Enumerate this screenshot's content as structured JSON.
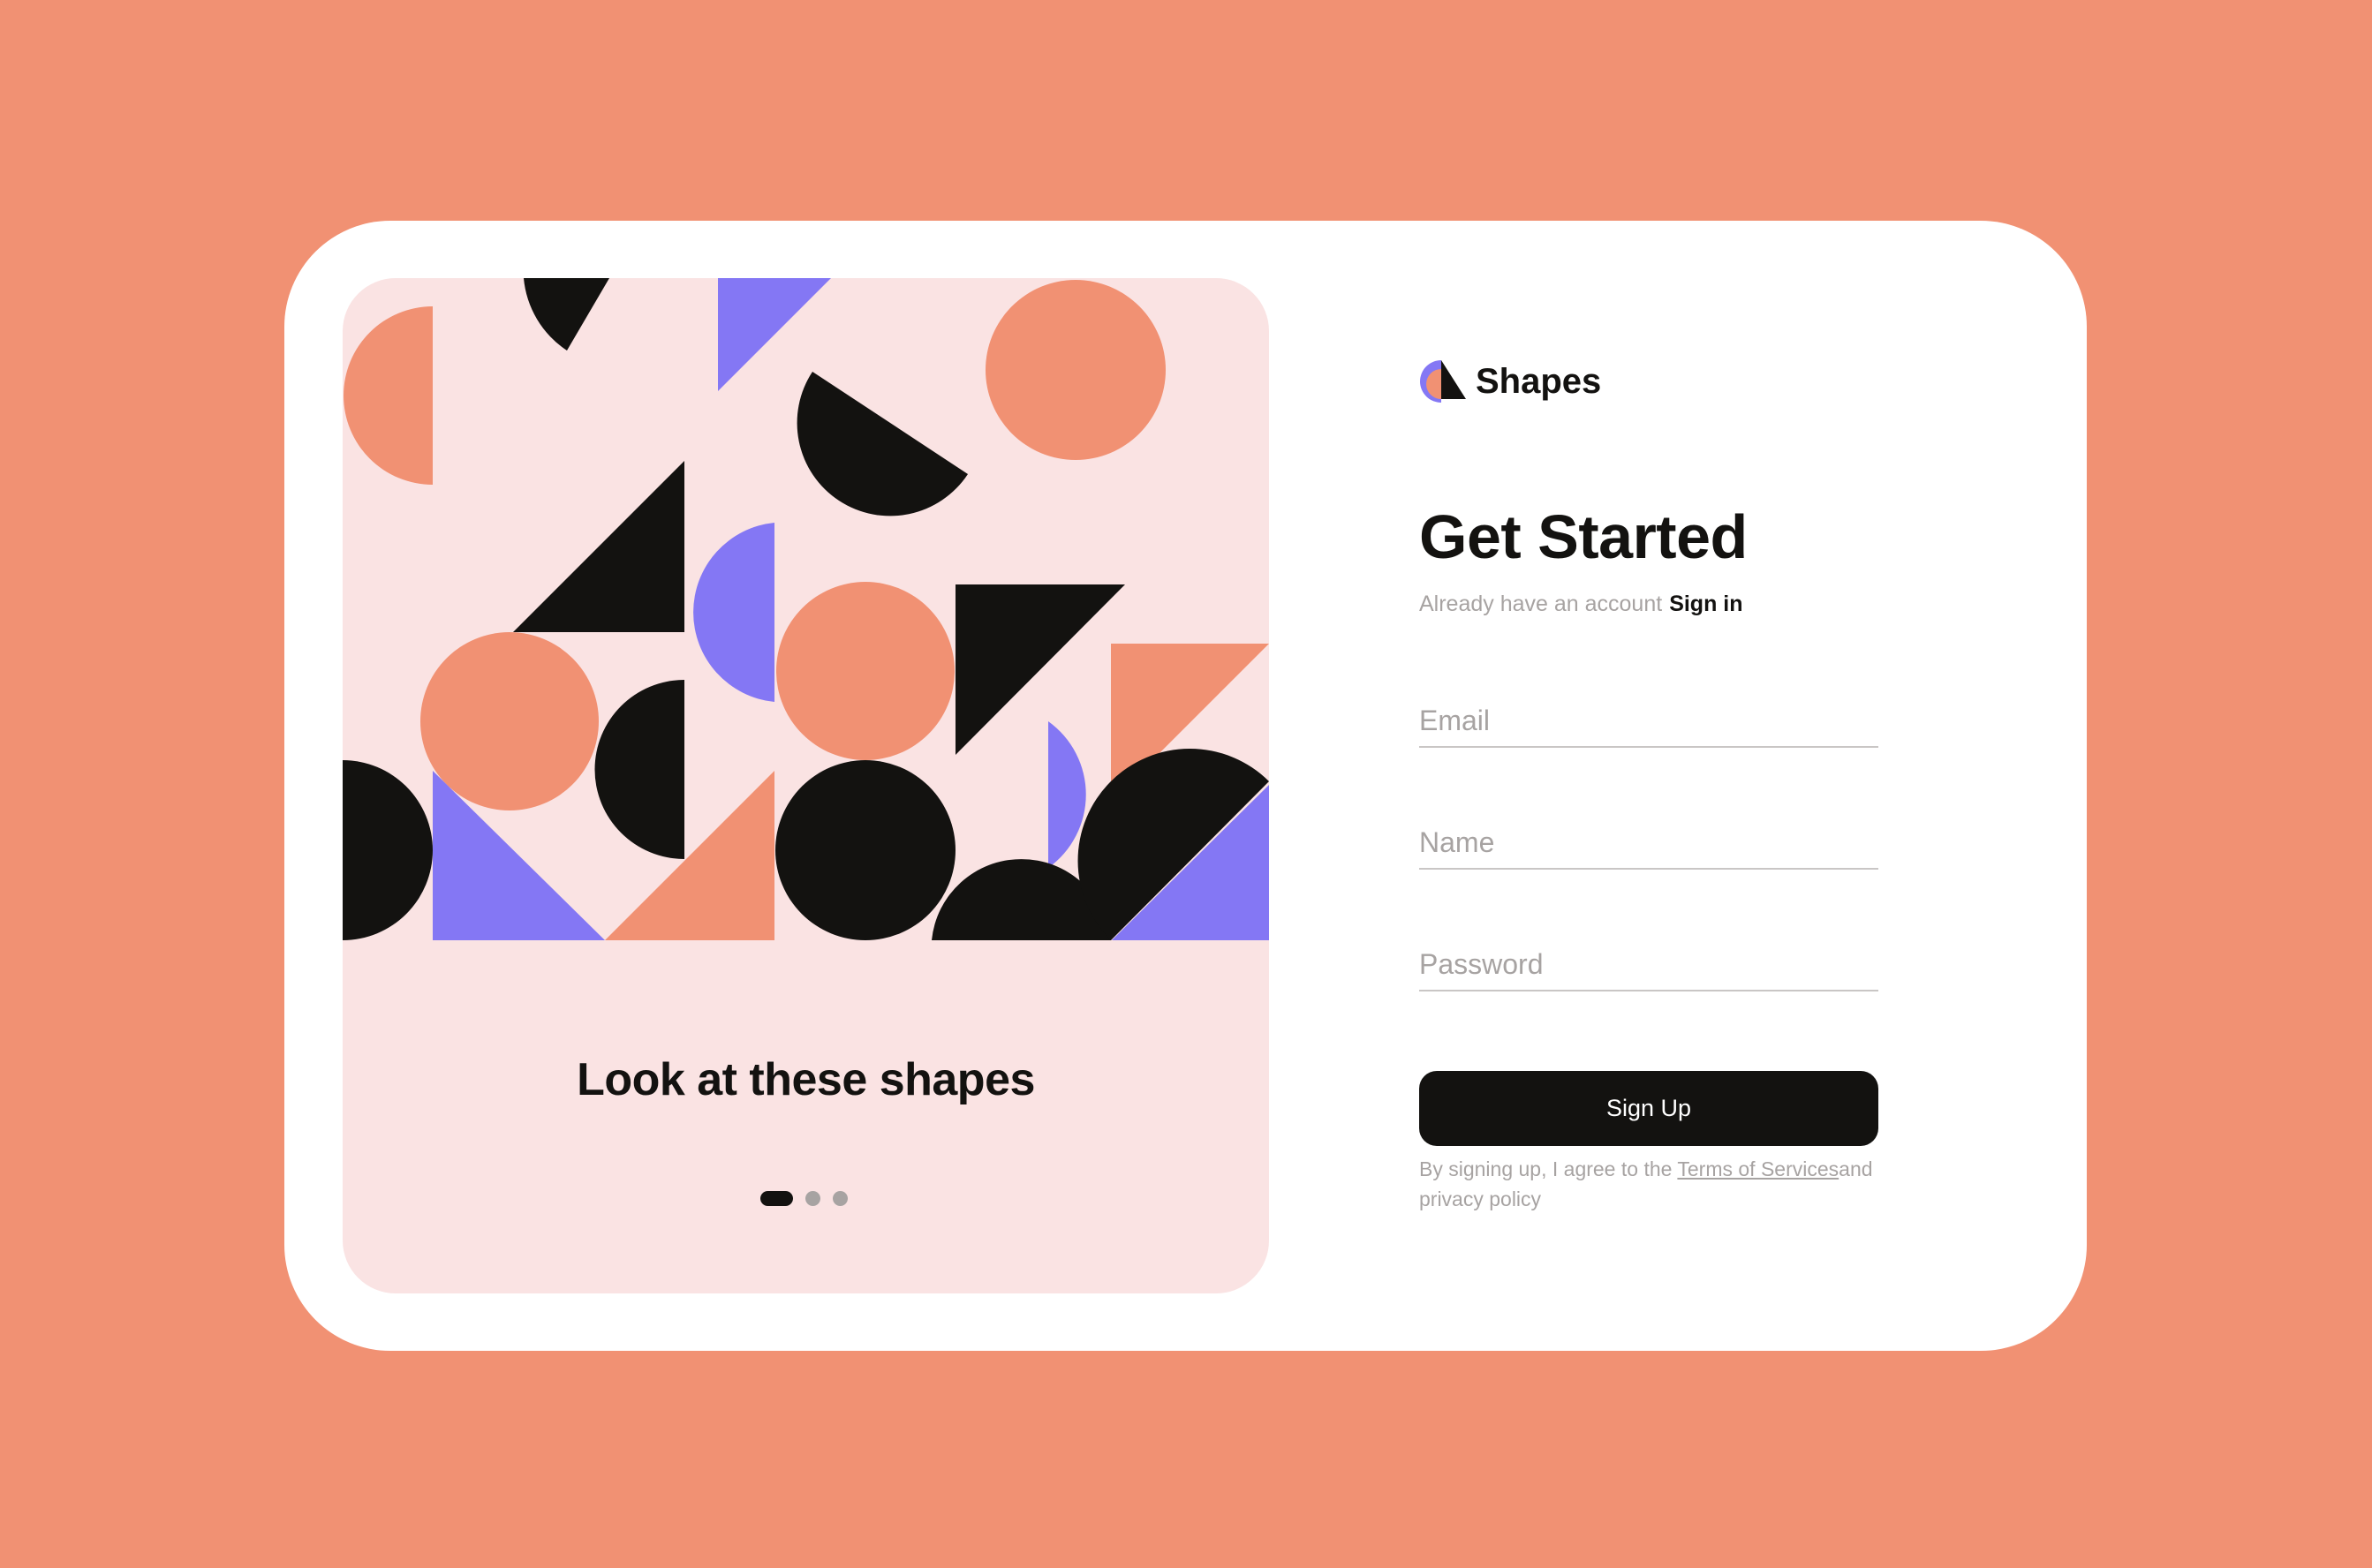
{
  "theme": {
    "background": "#f19173",
    "card": "#ffffff",
    "panel": "#fae3e3",
    "black": "#131210",
    "purple": "#8477f4",
    "salmon": "#f19173",
    "muted": "#a7a3a2"
  },
  "showcase": {
    "caption": "Look at these shapes",
    "slide_count": 3,
    "active_slide": 1
  },
  "brand": {
    "name": "Shapes",
    "logo_icon": "shapes-logo-icon"
  },
  "signup": {
    "title": "Get Started",
    "account_prompt": "Already have an account",
    "signin_label": "Sign in",
    "email": {
      "placeholder": "Email",
      "value": ""
    },
    "name": {
      "placeholder": "Name",
      "value": ""
    },
    "password": {
      "placeholder": "Password",
      "value": ""
    },
    "submit_label": "Sign Up",
    "terms_prefix": "By signing up, I agree to the ",
    "terms_link": "Terms of Services",
    "terms_suffix": "and privacy policy"
  }
}
